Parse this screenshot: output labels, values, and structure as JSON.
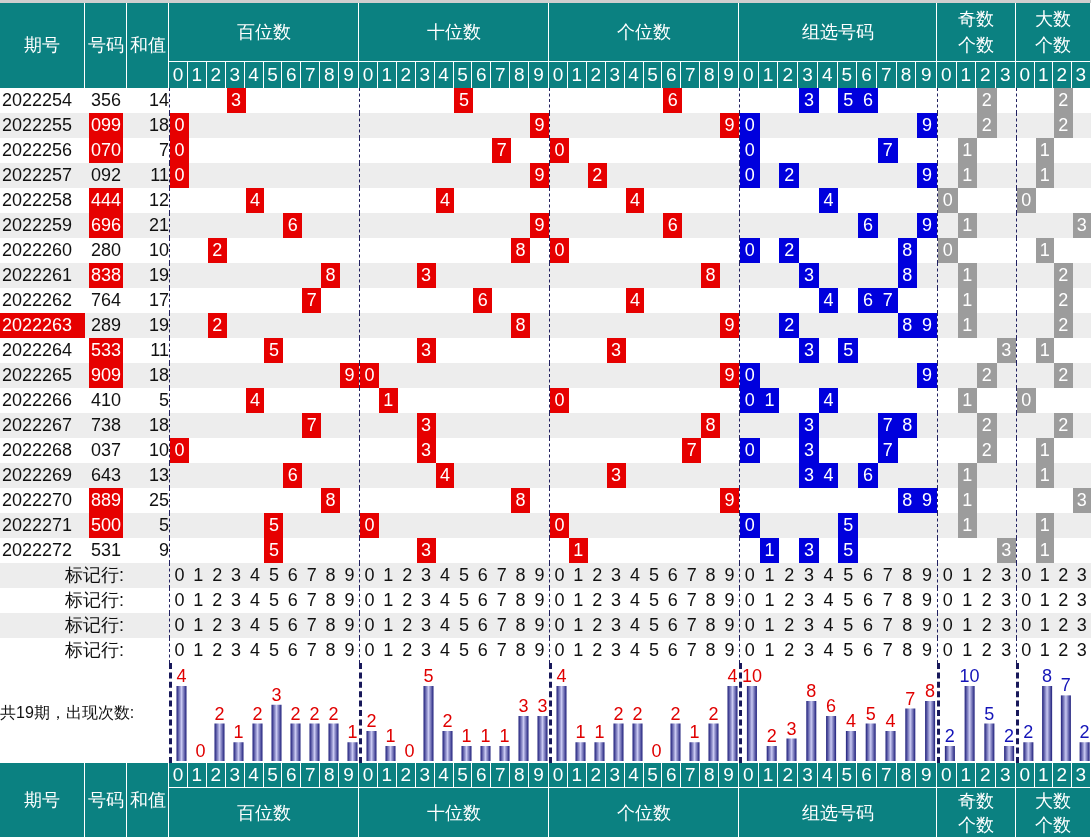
{
  "header": {
    "issue": "期号",
    "number": "号码",
    "sum": "和值",
    "sections": [
      {
        "kind": "position",
        "title": "百位数",
        "digits": [
          "0",
          "1",
          "2",
          "3",
          "4",
          "5",
          "6",
          "7",
          "8",
          "9"
        ]
      },
      {
        "kind": "position",
        "title": "十位数",
        "digits": [
          "0",
          "1",
          "2",
          "3",
          "4",
          "5",
          "6",
          "7",
          "8",
          "9"
        ]
      },
      {
        "kind": "position",
        "title": "个位数",
        "digits": [
          "0",
          "1",
          "2",
          "3",
          "4",
          "5",
          "6",
          "7",
          "8",
          "9"
        ]
      },
      {
        "kind": "group",
        "title": "组选号码",
        "digits": [
          "0",
          "1",
          "2",
          "3",
          "4",
          "5",
          "6",
          "7",
          "8",
          "9"
        ]
      },
      {
        "kind": "count",
        "title": "奇数个数",
        "digits": [
          "0",
          "1",
          "2",
          "3"
        ]
      },
      {
        "kind": "count",
        "title": "大数个数",
        "digits": [
          "0",
          "1",
          "2",
          "3"
        ]
      }
    ]
  },
  "rows": [
    {
      "issue": "2022254",
      "issue_highlighted": false,
      "number": "356",
      "number_highlighted": false,
      "sum": "14",
      "marks": [
        [
          "3"
        ],
        [
          "5"
        ],
        [
          "6"
        ],
        [
          "3",
          "5",
          "6"
        ],
        [
          "2"
        ],
        [
          "2"
        ]
      ]
    },
    {
      "issue": "2022255",
      "issue_highlighted": false,
      "number": "099",
      "number_highlighted": true,
      "sum": "18",
      "marks": [
        [
          "0"
        ],
        [
          "9"
        ],
        [
          "9"
        ],
        [
          "0",
          "9"
        ],
        [
          "2"
        ],
        [
          "2"
        ]
      ]
    },
    {
      "issue": "2022256",
      "issue_highlighted": false,
      "number": "070",
      "number_highlighted": true,
      "sum": "7",
      "marks": [
        [
          "0"
        ],
        [
          "7"
        ],
        [
          "0"
        ],
        [
          "0",
          "7"
        ],
        [
          "1"
        ],
        [
          "1"
        ]
      ]
    },
    {
      "issue": "2022257",
      "issue_highlighted": false,
      "number": "092",
      "number_highlighted": false,
      "sum": "11",
      "marks": [
        [
          "0"
        ],
        [
          "9"
        ],
        [
          "2"
        ],
        [
          "0",
          "2",
          "9"
        ],
        [
          "1"
        ],
        [
          "1"
        ]
      ]
    },
    {
      "issue": "2022258",
      "issue_highlighted": false,
      "number": "444",
      "number_highlighted": true,
      "sum": "12",
      "marks": [
        [
          "4"
        ],
        [
          "4"
        ],
        [
          "4"
        ],
        [
          "4"
        ],
        [
          "0"
        ],
        [
          "0"
        ]
      ]
    },
    {
      "issue": "2022259",
      "issue_highlighted": false,
      "number": "696",
      "number_highlighted": true,
      "sum": "21",
      "marks": [
        [
          "6"
        ],
        [
          "9"
        ],
        [
          "6"
        ],
        [
          "6",
          "9"
        ],
        [
          "1"
        ],
        [
          "3"
        ]
      ]
    },
    {
      "issue": "2022260",
      "issue_highlighted": false,
      "number": "280",
      "number_highlighted": false,
      "sum": "10",
      "marks": [
        [
          "2"
        ],
        [
          "8"
        ],
        [
          "0"
        ],
        [
          "0",
          "2",
          "8"
        ],
        [
          "0"
        ],
        [
          "1"
        ]
      ]
    },
    {
      "issue": "2022261",
      "issue_highlighted": false,
      "number": "838",
      "number_highlighted": true,
      "sum": "19",
      "marks": [
        [
          "8"
        ],
        [
          "3"
        ],
        [
          "8"
        ],
        [
          "3",
          "8"
        ],
        [
          "1"
        ],
        [
          "2"
        ]
      ]
    },
    {
      "issue": "2022262",
      "issue_highlighted": false,
      "number": "764",
      "number_highlighted": false,
      "sum": "17",
      "marks": [
        [
          "7"
        ],
        [
          "6"
        ],
        [
          "4"
        ],
        [
          "4",
          "6",
          "7"
        ],
        [
          "1"
        ],
        [
          "2"
        ]
      ]
    },
    {
      "issue": "2022263",
      "issue_highlighted": true,
      "number": "289",
      "number_highlighted": false,
      "sum": "19",
      "marks": [
        [
          "2"
        ],
        [
          "8"
        ],
        [
          "9"
        ],
        [
          "2",
          "8",
          "9"
        ],
        [
          "1"
        ],
        [
          "2"
        ]
      ]
    },
    {
      "issue": "2022264",
      "issue_highlighted": false,
      "number": "533",
      "number_highlighted": true,
      "sum": "11",
      "marks": [
        [
          "5"
        ],
        [
          "3"
        ],
        [
          "3"
        ],
        [
          "3",
          "5"
        ],
        [
          "3"
        ],
        [
          "1"
        ]
      ]
    },
    {
      "issue": "2022265",
      "issue_highlighted": false,
      "number": "909",
      "number_highlighted": true,
      "sum": "18",
      "marks": [
        [
          "9"
        ],
        [
          "0"
        ],
        [
          "9"
        ],
        [
          "0",
          "9"
        ],
        [
          "2"
        ],
        [
          "2"
        ]
      ]
    },
    {
      "issue": "2022266",
      "issue_highlighted": false,
      "number": "410",
      "number_highlighted": false,
      "sum": "5",
      "marks": [
        [
          "4"
        ],
        [
          "1"
        ],
        [
          "0"
        ],
        [
          "0",
          "1",
          "4"
        ],
        [
          "1"
        ],
        [
          "0"
        ]
      ]
    },
    {
      "issue": "2022267",
      "issue_highlighted": false,
      "number": "738",
      "number_highlighted": false,
      "sum": "18",
      "marks": [
        [
          "7"
        ],
        [
          "3"
        ],
        [
          "8"
        ],
        [
          "3",
          "7",
          "8"
        ],
        [
          "2"
        ],
        [
          "2"
        ]
      ]
    },
    {
      "issue": "2022268",
      "issue_highlighted": false,
      "number": "037",
      "number_highlighted": false,
      "sum": "10",
      "marks": [
        [
          "0"
        ],
        [
          "3"
        ],
        [
          "7"
        ],
        [
          "0",
          "3",
          "7"
        ],
        [
          "2"
        ],
        [
          "1"
        ]
      ]
    },
    {
      "issue": "2022269",
      "issue_highlighted": false,
      "number": "643",
      "number_highlighted": false,
      "sum": "13",
      "marks": [
        [
          "6"
        ],
        [
          "4"
        ],
        [
          "3"
        ],
        [
          "3",
          "4",
          "6"
        ],
        [
          "1"
        ],
        [
          "1"
        ]
      ]
    },
    {
      "issue": "2022270",
      "issue_highlighted": false,
      "number": "889",
      "number_highlighted": true,
      "sum": "25",
      "marks": [
        [
          "8"
        ],
        [
          "8"
        ],
        [
          "9"
        ],
        [
          "8",
          "9"
        ],
        [
          "1"
        ],
        [
          "3"
        ]
      ]
    },
    {
      "issue": "2022271",
      "issue_highlighted": false,
      "number": "500",
      "number_highlighted": true,
      "sum": "5",
      "marks": [
        [
          "5"
        ],
        [
          "0"
        ],
        [
          "0"
        ],
        [
          "0",
          "5"
        ],
        [
          "1"
        ],
        [
          "1"
        ]
      ]
    },
    {
      "issue": "2022272",
      "issue_highlighted": false,
      "number": "531",
      "number_highlighted": false,
      "sum": "9",
      "marks": [
        [
          "5"
        ],
        [
          "3"
        ],
        [
          "1"
        ],
        [
          "1",
          "3",
          "5"
        ],
        [
          "3"
        ],
        [
          "1"
        ]
      ]
    }
  ],
  "mark_rows": [
    {
      "label": "标记行:",
      "digits": [
        [
          "0",
          "1",
          "2",
          "3",
          "4",
          "5",
          "6",
          "7",
          "8",
          "9"
        ],
        [
          "0",
          "1",
          "2",
          "3",
          "4",
          "5",
          "6",
          "7",
          "8",
          "9"
        ],
        [
          "0",
          "1",
          "2",
          "3",
          "4",
          "5",
          "6",
          "7",
          "8",
          "9"
        ],
        [
          "0",
          "1",
          "2",
          "3",
          "4",
          "5",
          "6",
          "7",
          "8",
          "9"
        ],
        [
          "0",
          "1",
          "2",
          "3"
        ],
        [
          "0",
          "1",
          "2",
          "3"
        ]
      ]
    },
    {
      "label": "标记行:",
      "digits": [
        [
          "0",
          "1",
          "2",
          "3",
          "4",
          "5",
          "6",
          "7",
          "8",
          "9"
        ],
        [
          "0",
          "1",
          "2",
          "3",
          "4",
          "5",
          "6",
          "7",
          "8",
          "9"
        ],
        [
          "0",
          "1",
          "2",
          "3",
          "4",
          "5",
          "6",
          "7",
          "8",
          "9"
        ],
        [
          "0",
          "1",
          "2",
          "3",
          "4",
          "5",
          "6",
          "7",
          "8",
          "9"
        ],
        [
          "0",
          "1",
          "2",
          "3"
        ],
        [
          "0",
          "1",
          "2",
          "3"
        ]
      ]
    },
    {
      "label": "标记行:",
      "digits": [
        [
          "0",
          "1",
          "2",
          "3",
          "4",
          "5",
          "6",
          "7",
          "8",
          "9"
        ],
        [
          "0",
          "1",
          "2",
          "3",
          "4",
          "5",
          "6",
          "7",
          "8",
          "9"
        ],
        [
          "0",
          "1",
          "2",
          "3",
          "4",
          "5",
          "6",
          "7",
          "8",
          "9"
        ],
        [
          "0",
          "1",
          "2",
          "3",
          "4",
          "5",
          "6",
          "7",
          "8",
          "9"
        ],
        [
          "0",
          "1",
          "2",
          "3"
        ],
        [
          "0",
          "1",
          "2",
          "3"
        ]
      ]
    },
    {
      "label": "标记行:",
      "digits": [
        [
          "0",
          "1",
          "2",
          "3",
          "4",
          "5",
          "6",
          "7",
          "8",
          "9"
        ],
        [
          "0",
          "1",
          "2",
          "3",
          "4",
          "5",
          "6",
          "7",
          "8",
          "9"
        ],
        [
          "0",
          "1",
          "2",
          "3",
          "4",
          "5",
          "6",
          "7",
          "8",
          "9"
        ],
        [
          "0",
          "1",
          "2",
          "3",
          "4",
          "5",
          "6",
          "7",
          "8",
          "9"
        ],
        [
          "0",
          "1",
          "2",
          "3"
        ],
        [
          "0",
          "1",
          "2",
          "3"
        ]
      ]
    }
  ],
  "summary": {
    "label": "共19期，出现次数:",
    "charts": [
      {
        "chart_data": {
          "type": "bar",
          "categories": [
            "0",
            "1",
            "2",
            "3",
            "4",
            "5",
            "6",
            "7",
            "8",
            "9"
          ],
          "values": [
            4,
            0,
            2,
            1,
            2,
            3,
            2,
            2,
            2,
            1
          ],
          "data_labels": true
        }
      },
      {
        "chart_data": {
          "type": "bar",
          "categories": [
            "0",
            "1",
            "2",
            "3",
            "4",
            "5",
            "6",
            "7",
            "8",
            "9"
          ],
          "values": [
            2,
            1,
            0,
            5,
            2,
            1,
            1,
            1,
            3,
            3
          ],
          "data_labels": true
        }
      },
      {
        "chart_data": {
          "type": "bar",
          "categories": [
            "0",
            "1",
            "2",
            "3",
            "4",
            "5",
            "6",
            "7",
            "8",
            "9"
          ],
          "values": [
            4,
            1,
            1,
            2,
            2,
            0,
            2,
            1,
            2,
            4
          ],
          "data_labels": true
        }
      },
      {
        "chart_data": {
          "type": "bar",
          "categories": [
            "0",
            "1",
            "2",
            "3",
            "4",
            "5",
            "6",
            "7",
            "8",
            "9"
          ],
          "values": [
            10,
            2,
            3,
            8,
            6,
            4,
            5,
            4,
            7,
            8
          ],
          "data_labels": true
        }
      },
      {
        "chart_data": {
          "type": "bar",
          "categories": [
            "0",
            "1",
            "2",
            "3"
          ],
          "values": [
            2,
            10,
            5,
            2
          ],
          "data_labels": true
        }
      },
      {
        "chart_data": {
          "type": "bar",
          "categories": [
            "0",
            "1",
            "2",
            "3"
          ],
          "values": [
            2,
            8,
            7,
            2
          ],
          "data_labels": true
        }
      }
    ]
  },
  "footer": {
    "issue": "期号",
    "number": "号码",
    "sum": "和值",
    "titles": [
      "百位数",
      "十位数",
      "个位数",
      "组选号码",
      "奇数个数",
      "大数个数"
    ]
  }
}
